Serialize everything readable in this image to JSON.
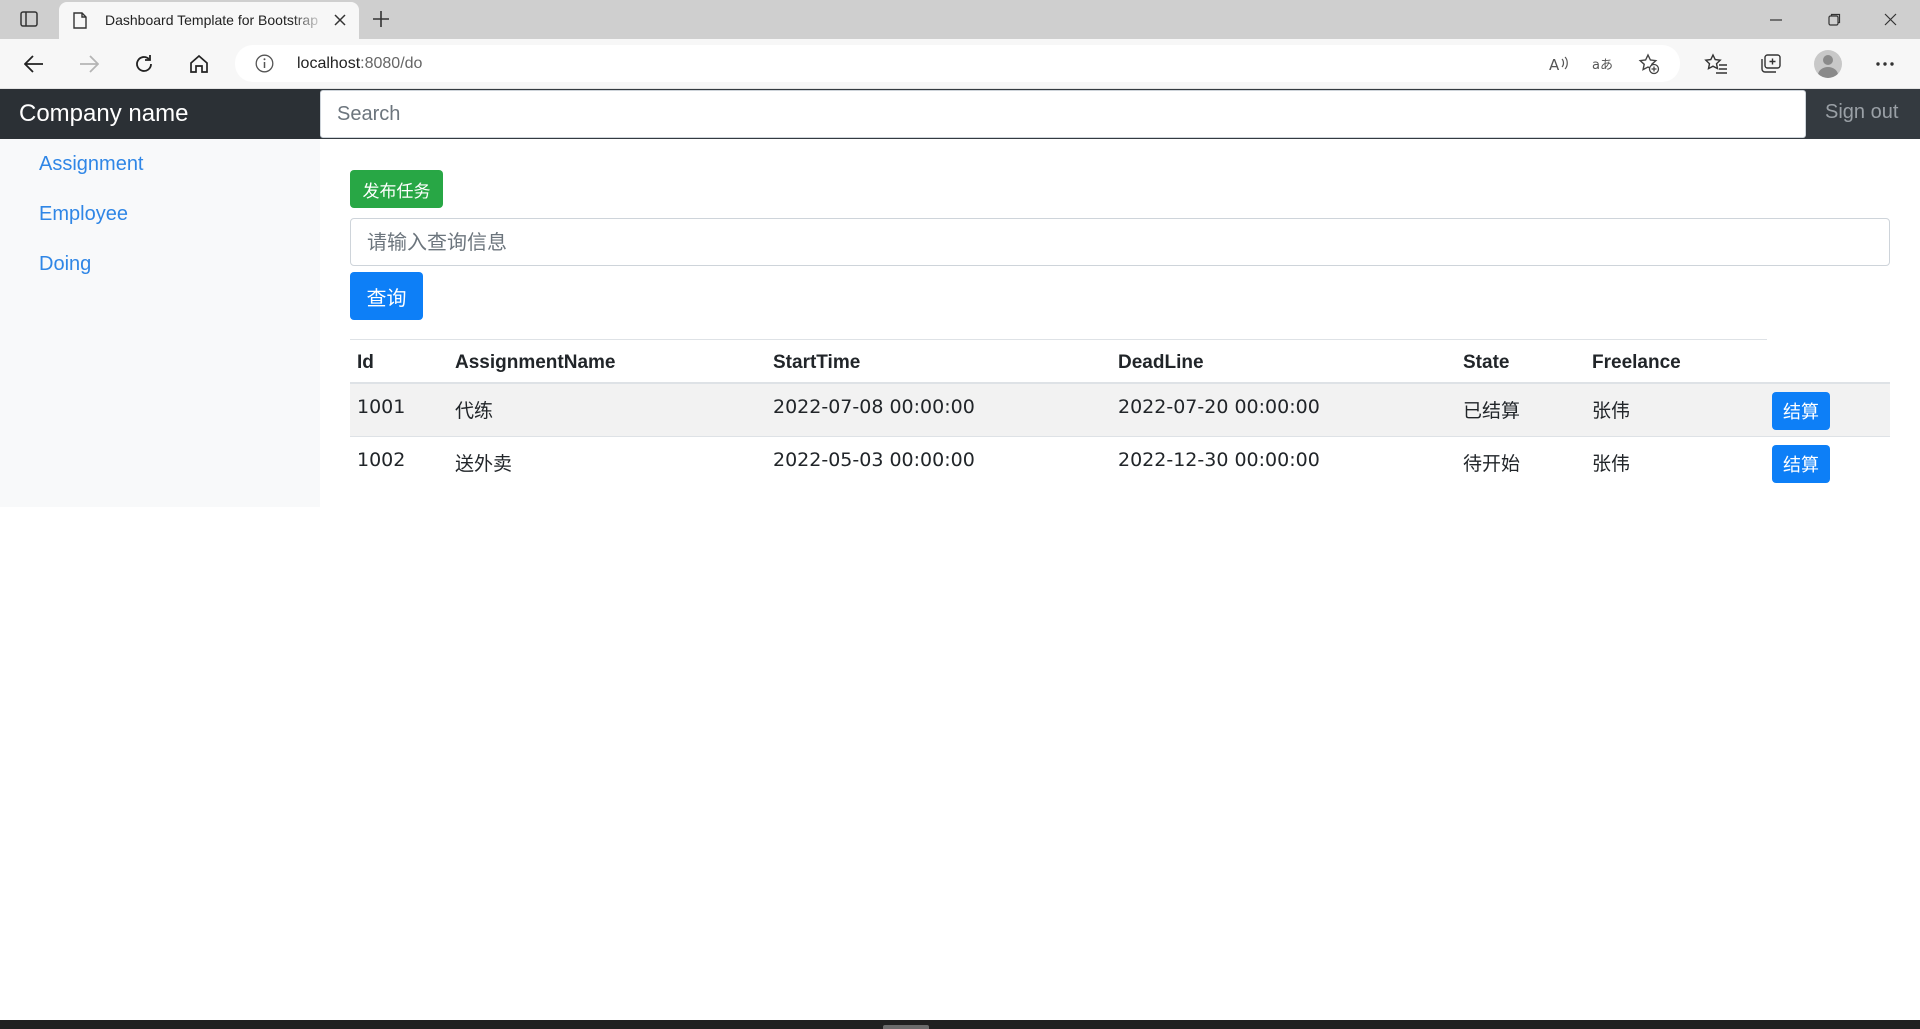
{
  "browser": {
    "tab_title": "Dashboard Template for Bootstrap",
    "url_host": "localhost",
    "url_rest": ":8080/do"
  },
  "navbar": {
    "brand": "Company name",
    "search_placeholder": "Search",
    "signout_label": "Sign out"
  },
  "sidebar": {
    "items": [
      {
        "label": "Assignment"
      },
      {
        "label": "Employee"
      },
      {
        "label": "Doing"
      }
    ]
  },
  "main": {
    "publish_label": "发布任务",
    "query_placeholder": "请输入查询信息",
    "query_button": "查询"
  },
  "table": {
    "headers": [
      "Id",
      "AssignmentName",
      "StartTime",
      "DeadLine",
      "State",
      "Freelance"
    ],
    "rows": [
      {
        "id": "1001",
        "name": "代练",
        "start": "2022-07-08 00:00:00",
        "deadline": "2022-07-20 00:00:00",
        "state": "已结算",
        "freelance": "张伟",
        "action": "结算"
      },
      {
        "id": "1002",
        "name": "送外卖",
        "start": "2022-05-03 00:00:00",
        "deadline": "2022-12-30 00:00:00",
        "state": "待开始",
        "freelance": "张伟",
        "action": "结算"
      }
    ]
  },
  "colors": {
    "navbar_bg": "#343a40",
    "success": "#28a745",
    "primary": "#0d7ff7",
    "link": "#2f86e6"
  }
}
